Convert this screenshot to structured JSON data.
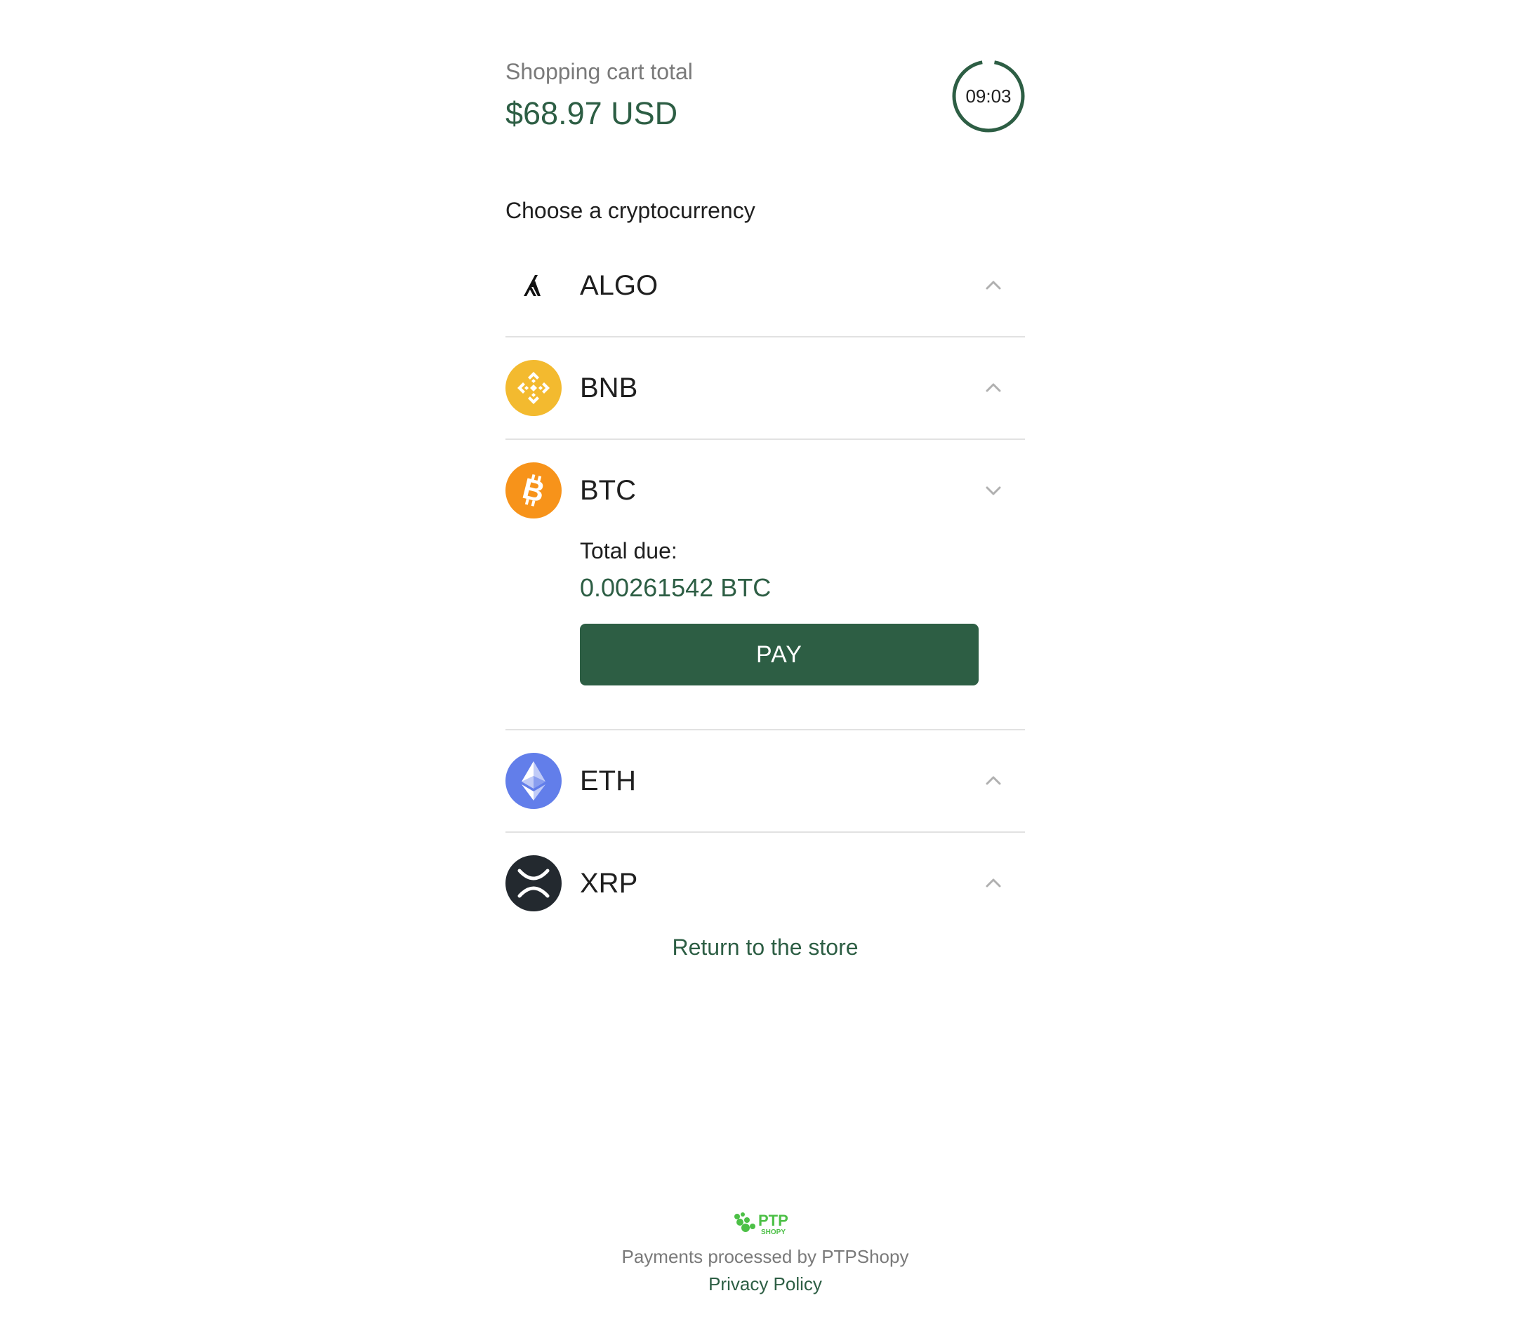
{
  "header": {
    "cart_label": "Shopping cart total",
    "cart_total": "$68.97 USD",
    "timer": "09:03"
  },
  "choose_label": "Choose a cryptocurrency",
  "cryptos": [
    {
      "name": "ALGO",
      "icon": "algo-icon",
      "expanded": false
    },
    {
      "name": "BNB",
      "icon": "bnb-icon",
      "expanded": false
    },
    {
      "name": "BTC",
      "icon": "btc-icon",
      "expanded": true
    },
    {
      "name": "ETH",
      "icon": "eth-icon",
      "expanded": false
    },
    {
      "name": "XRP",
      "icon": "xrp-icon",
      "expanded": false
    }
  ],
  "btc_panel": {
    "due_label": "Total due:",
    "due_value": "0.00261542 BTC",
    "pay_label": "PAY"
  },
  "return_link": "Return to the store",
  "footer": {
    "logo_text": "PTP",
    "logo_subtext": "SHOPY",
    "processed_by": "Payments processed by PTPShopy",
    "privacy": "Privacy Policy"
  },
  "colors": {
    "accent": "#2d5e44",
    "bnb": "#f3ba2f",
    "btc": "#f7931a",
    "eth": "#627eea",
    "xrp": "#23292f",
    "logo_green": "#4cc046"
  }
}
